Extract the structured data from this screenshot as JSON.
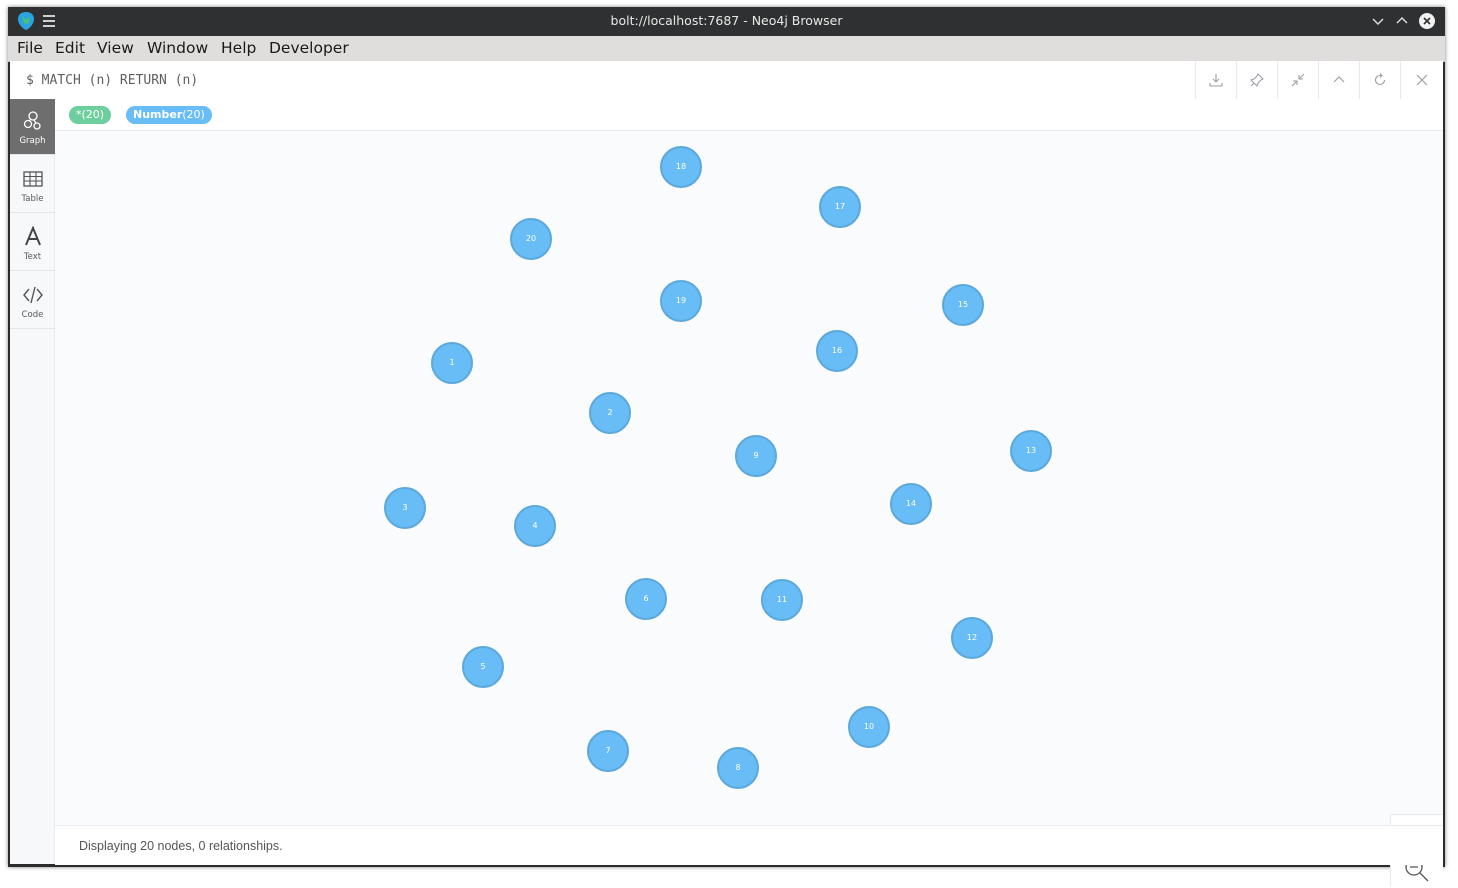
{
  "window": {
    "title": "bolt://localhost:7687 - Neo4j Browser",
    "icons": [
      "neo4j-logo-icon",
      "hamburger-menu-icon",
      "minimize-icon",
      "maximize-icon",
      "close-icon"
    ]
  },
  "menu": {
    "items": [
      "File",
      "Edit",
      "View",
      "Window",
      "Help",
      "Developer"
    ]
  },
  "editor": {
    "query": "$ MATCH (n) RETURN (n)",
    "toolbar_icons": [
      "download-icon",
      "pin-icon",
      "collapse-icon",
      "chevron-up-icon",
      "refresh-icon",
      "close-frame-icon"
    ]
  },
  "sidebar": {
    "items": [
      {
        "label": "Graph",
        "icon": "graph-icon",
        "active": true
      },
      {
        "label": "Table",
        "icon": "table-icon",
        "active": false
      },
      {
        "label": "Text",
        "icon": "text-icon",
        "active": false
      },
      {
        "label": "Code",
        "icon": "code-icon",
        "active": false
      }
    ]
  },
  "legend": {
    "all_label": "*",
    "all_count": "(20)",
    "all_color": "#6dce9e",
    "label_name": "Number",
    "label_count": "(20)",
    "label_color": "#68bdf6"
  },
  "graph": {
    "node_color": "#68bdf6",
    "nodes": [
      "18",
      "17",
      "20",
      "19",
      "15",
      "16",
      "1",
      "2",
      "9",
      "13",
      "3",
      "14",
      "4",
      "6",
      "11",
      "12",
      "5",
      "10",
      "7",
      "8"
    ]
  },
  "status": {
    "text": "Displaying 20 nodes, 0 relationships."
  }
}
